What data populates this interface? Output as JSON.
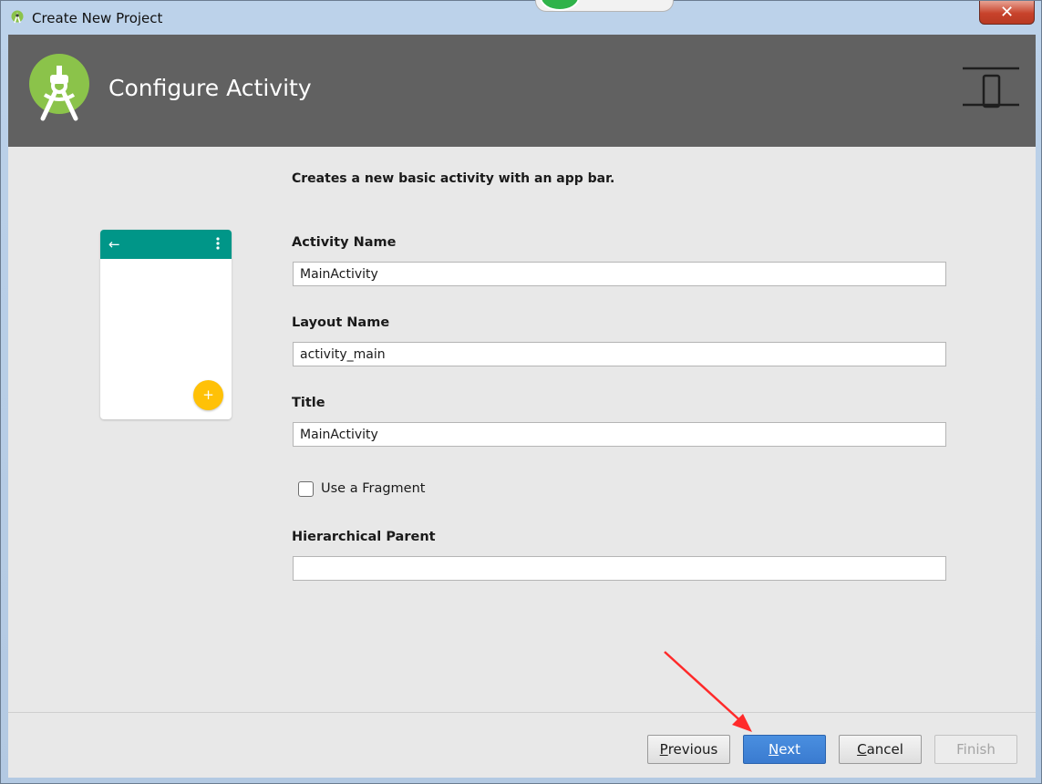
{
  "window": {
    "title": "Create New Project",
    "close_glyph": "✕"
  },
  "header": {
    "title": "Configure Activity",
    "logo_icon": "android-studio-logo-icon",
    "device_icon": "phone-device-icon",
    "colors": {
      "header_bg": "#616161",
      "logo_green": "#8bc34a"
    }
  },
  "description": "Creates a new basic activity with an app bar.",
  "preview": {
    "back_glyph": "←",
    "fab_glyph": "+",
    "colors": {
      "app_bar": "#009688",
      "fab": "#ffc107"
    }
  },
  "form": {
    "activity_name": {
      "label": "Activity Name",
      "value": "MainActivity"
    },
    "layout_name": {
      "label": "Layout Name",
      "value": "activity_main"
    },
    "title": {
      "label": "Title",
      "value": "MainActivity"
    },
    "use_fragment": {
      "label": "Use a Fragment",
      "checked": false
    },
    "hierarchical_parent": {
      "label": "Hierarchical Parent",
      "value": ""
    }
  },
  "buttons": {
    "previous": {
      "mnemonic": "P",
      "rest": "revious"
    },
    "next": {
      "mnemonic": "N",
      "rest": "ext"
    },
    "cancel": {
      "mnemonic": "C",
      "rest": "ancel"
    },
    "finish": {
      "label": "Finish",
      "enabled": false
    },
    "colors": {
      "next_bg": "#3a7bd0",
      "annotation_arrow": "#ff2a2a"
    }
  }
}
